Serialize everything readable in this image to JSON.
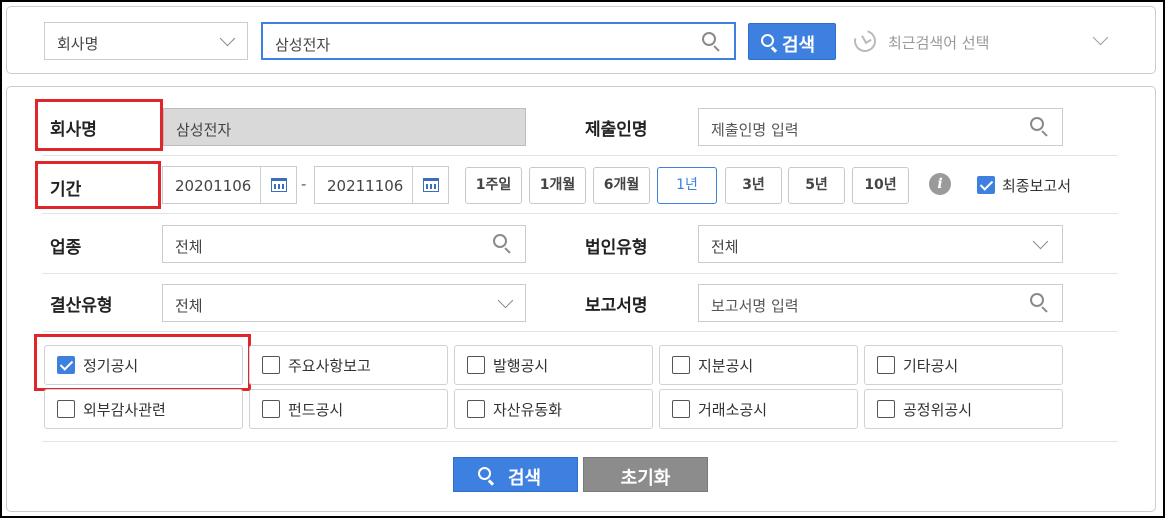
{
  "top_search": {
    "type_select": "회사명",
    "query_value": "삼성전자",
    "search_button": "검색",
    "recent_select": "최근검색어 선택"
  },
  "form": {
    "company": {
      "label": "회사명",
      "value": "삼성전자"
    },
    "submitter": {
      "label": "제출인명",
      "placeholder": "제출인명 입력"
    },
    "period": {
      "label": "기간",
      "start": "20201106",
      "separator": "-",
      "end": "20211106",
      "presets": [
        "1주일",
        "1개월",
        "6개월",
        "1년",
        "3년",
        "5년",
        "10년"
      ],
      "active_preset": "1년",
      "final_report_label": "최종보고서",
      "final_report_checked": true
    },
    "industry": {
      "label": "업종",
      "value": "전체"
    },
    "corp_type": {
      "label": "법인유형",
      "value": "전체"
    },
    "fiscal_type": {
      "label": "결산유형",
      "value": "전체"
    },
    "report_name": {
      "label": "보고서명",
      "placeholder": "보고서명 입력"
    }
  },
  "disclosure_types": [
    {
      "label": "정기공시",
      "checked": true
    },
    {
      "label": "주요사항보고",
      "checked": false
    },
    {
      "label": "발행공시",
      "checked": false
    },
    {
      "label": "지분공시",
      "checked": false
    },
    {
      "label": "기타공시",
      "checked": false
    },
    {
      "label": "외부감사관련",
      "checked": false
    },
    {
      "label": "펀드공시",
      "checked": false
    },
    {
      "label": "자산유동화",
      "checked": false
    },
    {
      "label": "거래소공시",
      "checked": false
    },
    {
      "label": "공정위공시",
      "checked": false
    }
  ],
  "actions": {
    "search": "검색",
    "reset": "초기화"
  },
  "colors": {
    "primary": "#3d80e0",
    "highlight": "#e0262b",
    "reset_gray": "#8c8c8c"
  }
}
